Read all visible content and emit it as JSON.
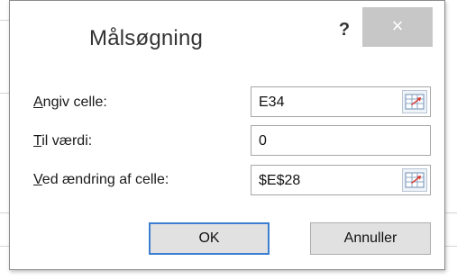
{
  "dialog": {
    "title": "Målsøgning",
    "help_label": "?",
    "close_label": "×"
  },
  "fields": {
    "set_cell": {
      "label_accel": "A",
      "label_rest": "ngiv celle:",
      "value": "E34"
    },
    "to_value": {
      "label_accel": "T",
      "label_rest": "il værdi:",
      "value": "0"
    },
    "by_changing": {
      "label_accel": "V",
      "label_rest": "ed ændring af celle:",
      "value": "$E$28"
    }
  },
  "buttons": {
    "ok_label": "OK",
    "cancel_label": "Annuller"
  }
}
